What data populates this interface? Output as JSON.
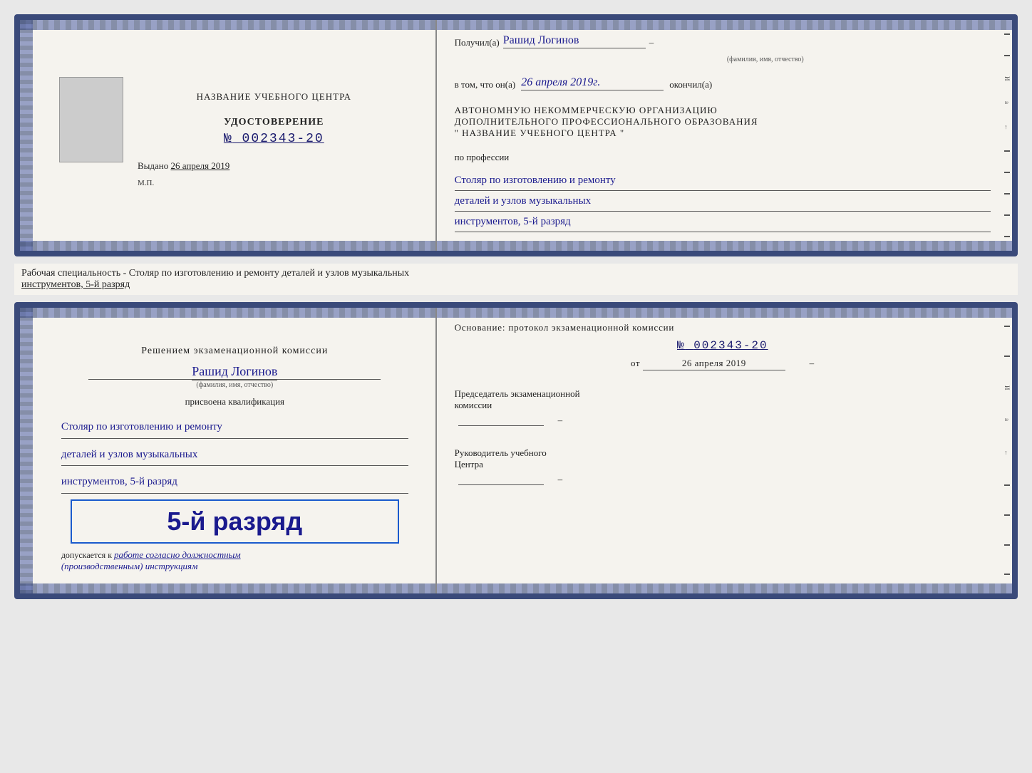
{
  "page": {
    "background_color": "#e8e8e8"
  },
  "doc1": {
    "left": {
      "training_center_label": "НАЗВАНИЕ УЧЕБНОГО ЦЕНТРА",
      "cert_title": "УДОСТОВЕРЕНИЕ",
      "cert_number_prefix": "№",
      "cert_number": "002343-20",
      "issued_label": "Выдано",
      "issued_date": "26 апреля 2019",
      "stamp_label": "М.П."
    },
    "right": {
      "received_label": "Получил(а)",
      "recipient_name": "Рашид Логинов",
      "fio_label": "(фамилия, имя, отчество)",
      "in_that_label": "в том, что он(а)",
      "completed_date": "26 апреля 2019г.",
      "completed_label": "окончил(а)",
      "org_line1": "АВТОНОМНУЮ НЕКОММЕРЧЕСКУЮ ОРГАНИЗАЦИЮ",
      "org_line2": "ДОПОЛНИТЕЛЬНОГО ПРОФЕССИОНАЛЬНОГО ОБРАЗОВАНИЯ",
      "org_line3": "\"  НАЗВАНИЕ УЧЕБНОГО ЦЕНТРА  \"",
      "profession_label": "по профессии",
      "profession_line1": "Столяр по изготовлению и ремонту",
      "profession_line2": "деталей и узлов музыкальных",
      "profession_line3": "инструментов, 5-й разряд"
    }
  },
  "between_label": {
    "text_prefix": "Рабочая специальность - Столяр по изготовлению и ремонту деталей и узлов музыкальных",
    "text_underline": "инструментов, 5-й разряд"
  },
  "doc2": {
    "left": {
      "commission_text": "Решением экзаменационной комиссии",
      "person_name": "Рашид Логинов",
      "fio_label": "(фамилия, имя, отчество)",
      "awarded_label": "присвоена квалификация",
      "qualification_line1": "Столяр по изготовлению и ремонту",
      "qualification_line2": "деталей и узлов музыкальных",
      "qualification_line3": "инструментов, 5-й разряд",
      "rank_label": "5-й разряд",
      "allowed_prefix": "допускается к",
      "allowed_text": "работе согласно должностным",
      "allowed_text2": "(производственным) инструкциям"
    },
    "right": {
      "basis_label": "Основание: протокол экзаменационной комиссии",
      "number_prefix": "№",
      "number": "002343-20",
      "date_prefix": "от",
      "date": "26 апреля 2019",
      "chairman_line1": "Председатель экзаменационной",
      "chairman_line2": "комиссии",
      "head_line1": "Руководитель учебного",
      "head_line2": "Центра"
    }
  }
}
